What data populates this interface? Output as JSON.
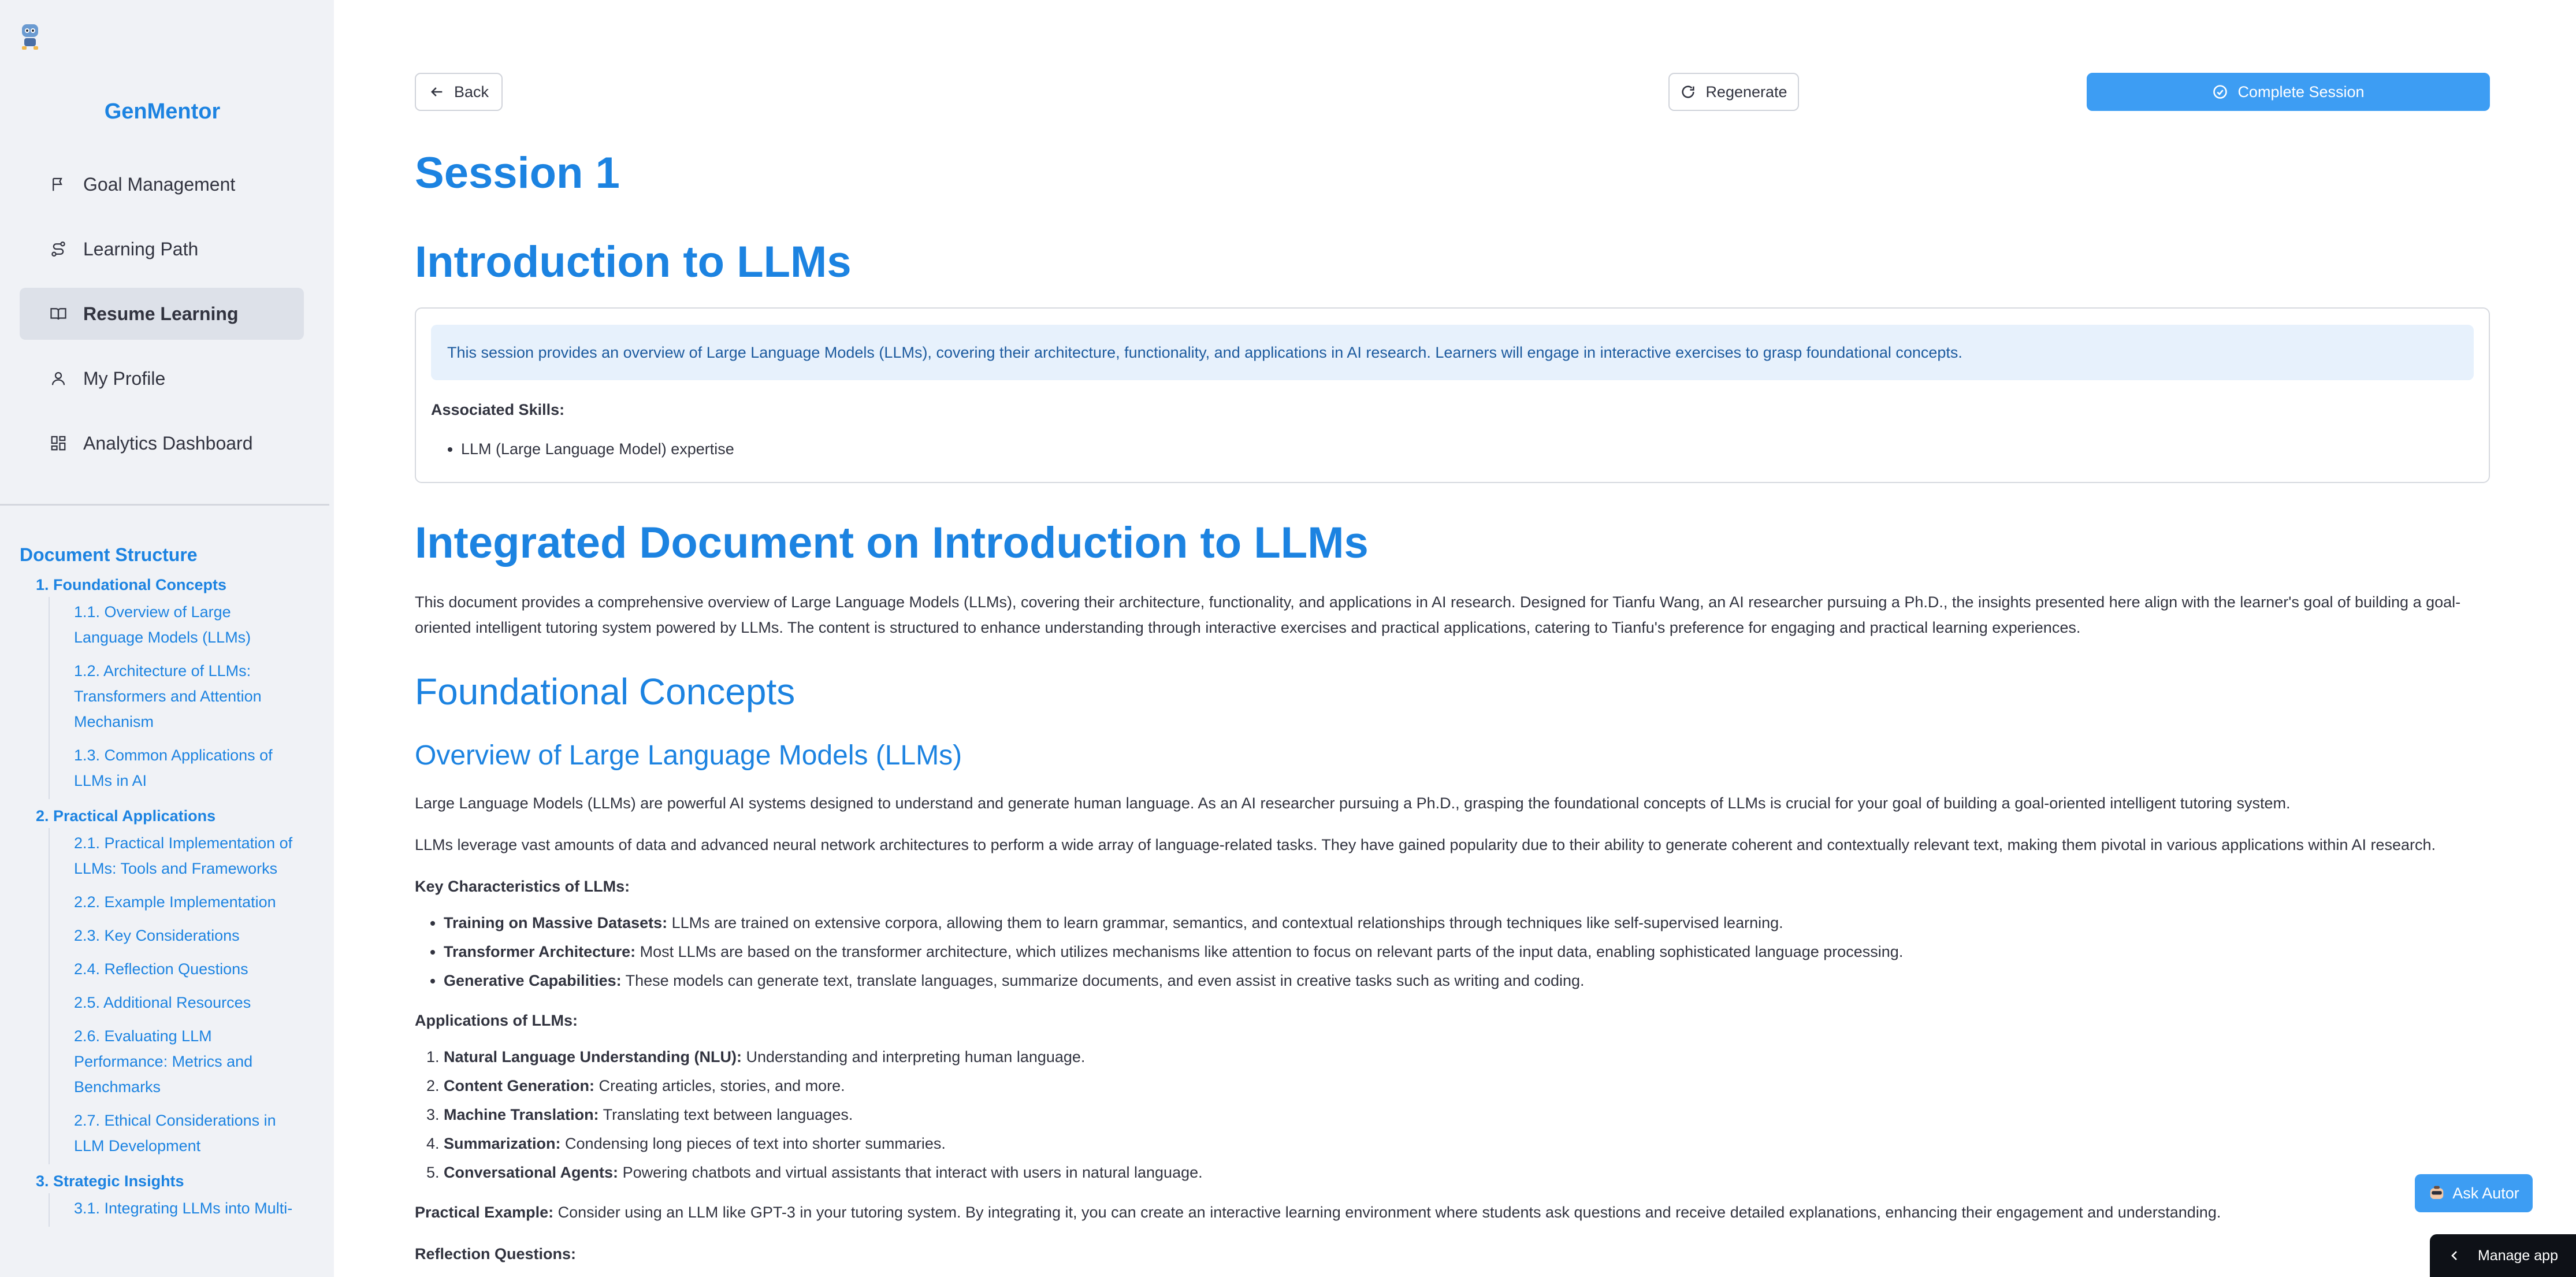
{
  "app": {
    "title": "GenMentor"
  },
  "nav": {
    "items": [
      {
        "label": "Goal Management",
        "icon": "flag-icon"
      },
      {
        "label": "Learning Path",
        "icon": "route-icon"
      },
      {
        "label": "Resume Learning",
        "icon": "book-icon",
        "active": true
      },
      {
        "label": "My Profile",
        "icon": "user-icon"
      },
      {
        "label": "Analytics Dashboard",
        "icon": "dashboard-icon"
      }
    ]
  },
  "doc_structure": {
    "title": "Document Structure",
    "sections": [
      {
        "label": "1. Foundational Concepts",
        "items": [
          "1.1. Overview of Large Language Models (LLMs)",
          "1.2. Architecture of LLMs: Transformers and Attention Mechanism",
          "1.3. Common Applications of LLMs in AI"
        ]
      },
      {
        "label": "2. Practical Applications",
        "items": [
          "2.1. Practical Implementation of LLMs: Tools and Frameworks",
          "2.2. Example Implementation",
          "2.3. Key Considerations",
          "2.4. Reflection Questions",
          "2.5. Additional Resources",
          "2.6. Evaluating LLM Performance: Metrics and Benchmarks",
          "2.7. Ethical Considerations in LLM Development"
        ]
      },
      {
        "label": "3. Strategic Insights",
        "items": [
          "3.1. Integrating LLMs into Multi-"
        ]
      }
    ]
  },
  "toolbar": {
    "back_label": "Back",
    "regenerate_label": "Regenerate",
    "complete_label": "Complete Session"
  },
  "session": {
    "title": "Session 1",
    "heading": "Introduction to LLMs",
    "summary": "This session provides an overview of Large Language Models (LLMs), covering their architecture, functionality, and applications in AI research. Learners will engage in interactive exercises to grasp foundational concepts.",
    "skills_label": "Associated Skills:",
    "skills": [
      "LLM (Large Language Model) expertise"
    ]
  },
  "document": {
    "title": "Integrated Document on Introduction to LLMs",
    "intro": "This document provides a comprehensive overview of Large Language Models (LLMs), covering their architecture, functionality, and applications in AI research. Designed for Tianfu Wang, an AI researcher pursuing a Ph.D., the insights presented here align with the learner's goal of building a goal-oriented intelligent tutoring system powered by LLMs. The content is structured to enhance understanding through interactive exercises and practical applications, catering to Tianfu's preference for engaging and practical learning experiences.",
    "section_title": "Foundational Concepts",
    "subsection_title": "Overview of Large Language Models (LLMs)",
    "para1": "Large Language Models (LLMs) are powerful AI systems designed to understand and generate human language. As an AI researcher pursuing a Ph.D., grasping the foundational concepts of LLMs is crucial for your goal of building a goal-oriented intelligent tutoring system.",
    "para2": "LLMs leverage vast amounts of data and advanced neural network architectures to perform a wide array of language-related tasks. They have gained popularity due to their ability to generate coherent and contextually relevant text, making them pivotal in various applications within AI research.",
    "key_label": "Key Characteristics of LLMs:",
    "key_items": [
      {
        "bold": "Training on Massive Datasets:",
        "text": " LLMs are trained on extensive corpora, allowing them to learn grammar, semantics, and contextual relationships through techniques like self-supervised learning."
      },
      {
        "bold": "Transformer Architecture:",
        "text": " Most LLMs are based on the transformer architecture, which utilizes mechanisms like attention to focus on relevant parts of the input data, enabling sophisticated language processing."
      },
      {
        "bold": "Generative Capabilities:",
        "text": " These models can generate text, translate languages, summarize documents, and even assist in creative tasks such as writing and coding."
      }
    ],
    "apps_label": "Applications of LLMs:",
    "apps_items": [
      {
        "bold": "Natural Language Understanding (NLU):",
        "text": " Understanding and interpreting human language."
      },
      {
        "bold": "Content Generation:",
        "text": " Creating articles, stories, and more."
      },
      {
        "bold": "Machine Translation:",
        "text": " Translating text between languages."
      },
      {
        "bold": "Summarization:",
        "text": " Condensing long pieces of text into shorter summaries."
      },
      {
        "bold": "Conversational Agents:",
        "text": " Powering chatbots and virtual assistants that interact with users in natural language."
      }
    ],
    "example_label": "Practical Example:",
    "example_text": " Consider using an LLM like GPT-3 in your tutoring system. By integrating it, you can create an interactive learning environment where students ask questions and receive detailed explanations, enhancing their engagement and understanding.",
    "reflection_label": "Reflection Questions:"
  },
  "floating": {
    "ask_label": "Ask Autor",
    "manage_label": "Manage app"
  },
  "colors": {
    "accent": "#1c83e1",
    "sidebar_bg": "#f0f2f6",
    "active_nav": "#dde1e9",
    "primary_button": "#3d9df3",
    "info_bg": "#e7f1fc"
  }
}
